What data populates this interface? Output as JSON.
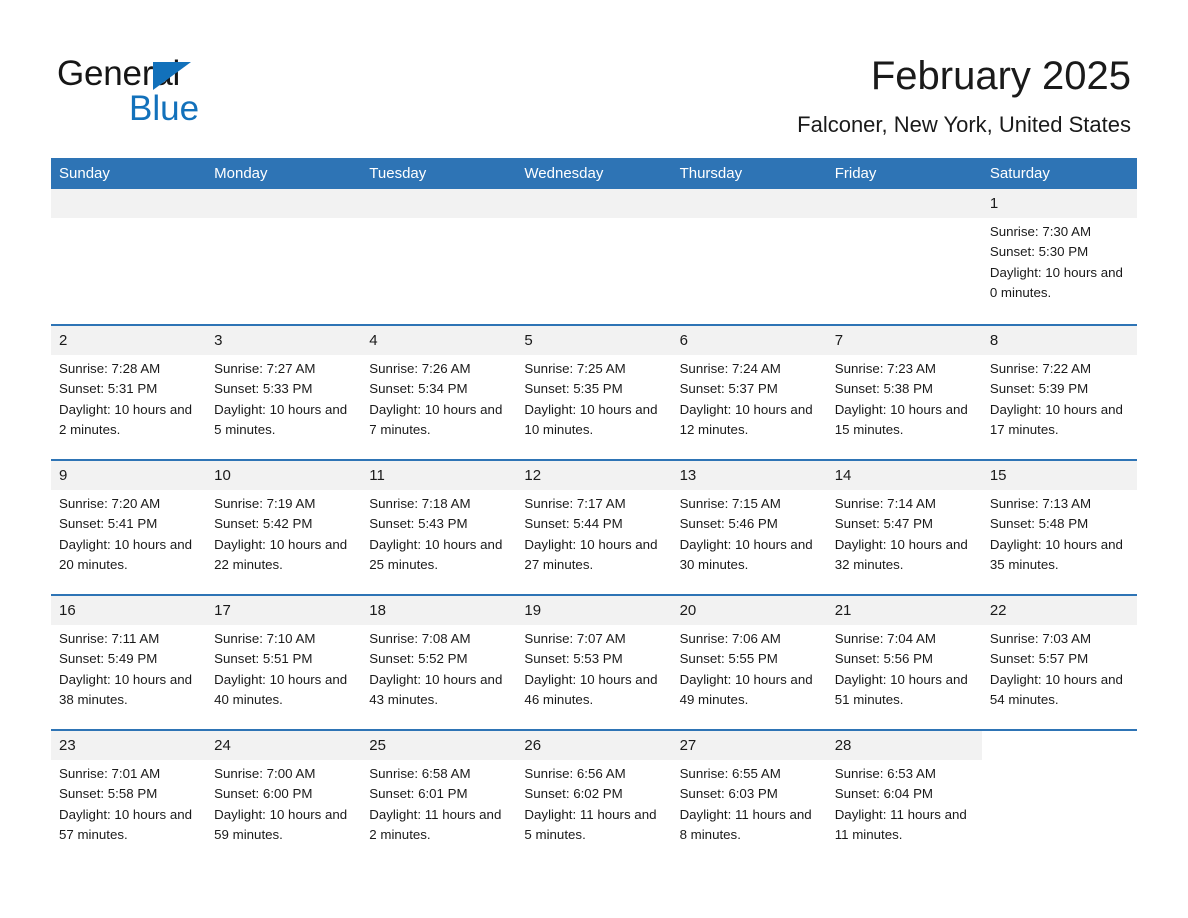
{
  "brand": {
    "word1": "General",
    "word2": "Blue",
    "flag_icon": "triangle-flag-icon",
    "accent_color": "#1271bb"
  },
  "header": {
    "title": "February 2025",
    "location": "Falconer, New York, United States"
  },
  "theme": {
    "header_bar_color": "#2e74b5",
    "date_band_color": "#f2f2f2",
    "text_color": "#1a1a1a"
  },
  "calendar": {
    "weekday_headers": [
      "Sunday",
      "Monday",
      "Tuesday",
      "Wednesday",
      "Thursday",
      "Friday",
      "Saturday"
    ],
    "weeks": [
      [
        {
          "day": "",
          "empty": true
        },
        {
          "day": "",
          "empty": true
        },
        {
          "day": "",
          "empty": true
        },
        {
          "day": "",
          "empty": true
        },
        {
          "day": "",
          "empty": true
        },
        {
          "day": "",
          "empty": true
        },
        {
          "day": "1",
          "sunrise": "Sunrise: 7:30 AM",
          "sunset": "Sunset: 5:30 PM",
          "daylight": "Daylight: 10 hours and 0 minutes."
        }
      ],
      [
        {
          "day": "2",
          "sunrise": "Sunrise: 7:28 AM",
          "sunset": "Sunset: 5:31 PM",
          "daylight": "Daylight: 10 hours and 2 minutes."
        },
        {
          "day": "3",
          "sunrise": "Sunrise: 7:27 AM",
          "sunset": "Sunset: 5:33 PM",
          "daylight": "Daylight: 10 hours and 5 minutes."
        },
        {
          "day": "4",
          "sunrise": "Sunrise: 7:26 AM",
          "sunset": "Sunset: 5:34 PM",
          "daylight": "Daylight: 10 hours and 7 minutes."
        },
        {
          "day": "5",
          "sunrise": "Sunrise: 7:25 AM",
          "sunset": "Sunset: 5:35 PM",
          "daylight": "Daylight: 10 hours and 10 minutes."
        },
        {
          "day": "6",
          "sunrise": "Sunrise: 7:24 AM",
          "sunset": "Sunset: 5:37 PM",
          "daylight": "Daylight: 10 hours and 12 minutes."
        },
        {
          "day": "7",
          "sunrise": "Sunrise: 7:23 AM",
          "sunset": "Sunset: 5:38 PM",
          "daylight": "Daylight: 10 hours and 15 minutes."
        },
        {
          "day": "8",
          "sunrise": "Sunrise: 7:22 AM",
          "sunset": "Sunset: 5:39 PM",
          "daylight": "Daylight: 10 hours and 17 minutes."
        }
      ],
      [
        {
          "day": "9",
          "sunrise": "Sunrise: 7:20 AM",
          "sunset": "Sunset: 5:41 PM",
          "daylight": "Daylight: 10 hours and 20 minutes."
        },
        {
          "day": "10",
          "sunrise": "Sunrise: 7:19 AM",
          "sunset": "Sunset: 5:42 PM",
          "daylight": "Daylight: 10 hours and 22 minutes."
        },
        {
          "day": "11",
          "sunrise": "Sunrise: 7:18 AM",
          "sunset": "Sunset: 5:43 PM",
          "daylight": "Daylight: 10 hours and 25 minutes."
        },
        {
          "day": "12",
          "sunrise": "Sunrise: 7:17 AM",
          "sunset": "Sunset: 5:44 PM",
          "daylight": "Daylight: 10 hours and 27 minutes."
        },
        {
          "day": "13",
          "sunrise": "Sunrise: 7:15 AM",
          "sunset": "Sunset: 5:46 PM",
          "daylight": "Daylight: 10 hours and 30 minutes."
        },
        {
          "day": "14",
          "sunrise": "Sunrise: 7:14 AM",
          "sunset": "Sunset: 5:47 PM",
          "daylight": "Daylight: 10 hours and 32 minutes."
        },
        {
          "day": "15",
          "sunrise": "Sunrise: 7:13 AM",
          "sunset": "Sunset: 5:48 PM",
          "daylight": "Daylight: 10 hours and 35 minutes."
        }
      ],
      [
        {
          "day": "16",
          "sunrise": "Sunrise: 7:11 AM",
          "sunset": "Sunset: 5:49 PM",
          "daylight": "Daylight: 10 hours and 38 minutes."
        },
        {
          "day": "17",
          "sunrise": "Sunrise: 7:10 AM",
          "sunset": "Sunset: 5:51 PM",
          "daylight": "Daylight: 10 hours and 40 minutes."
        },
        {
          "day": "18",
          "sunrise": "Sunrise: 7:08 AM",
          "sunset": "Sunset: 5:52 PM",
          "daylight": "Daylight: 10 hours and 43 minutes."
        },
        {
          "day": "19",
          "sunrise": "Sunrise: 7:07 AM",
          "sunset": "Sunset: 5:53 PM",
          "daylight": "Daylight: 10 hours and 46 minutes."
        },
        {
          "day": "20",
          "sunrise": "Sunrise: 7:06 AM",
          "sunset": "Sunset: 5:55 PM",
          "daylight": "Daylight: 10 hours and 49 minutes."
        },
        {
          "day": "21",
          "sunrise": "Sunrise: 7:04 AM",
          "sunset": "Sunset: 5:56 PM",
          "daylight": "Daylight: 10 hours and 51 minutes."
        },
        {
          "day": "22",
          "sunrise": "Sunrise: 7:03 AM",
          "sunset": "Sunset: 5:57 PM",
          "daylight": "Daylight: 10 hours and 54 minutes."
        }
      ],
      [
        {
          "day": "23",
          "sunrise": "Sunrise: 7:01 AM",
          "sunset": "Sunset: 5:58 PM",
          "daylight": "Daylight: 10 hours and 57 minutes."
        },
        {
          "day": "24",
          "sunrise": "Sunrise: 7:00 AM",
          "sunset": "Sunset: 6:00 PM",
          "daylight": "Daylight: 10 hours and 59 minutes."
        },
        {
          "day": "25",
          "sunrise": "Sunrise: 6:58 AM",
          "sunset": "Sunset: 6:01 PM",
          "daylight": "Daylight: 11 hours and 2 minutes."
        },
        {
          "day": "26",
          "sunrise": "Sunrise: 6:56 AM",
          "sunset": "Sunset: 6:02 PM",
          "daylight": "Daylight: 11 hours and 5 minutes."
        },
        {
          "day": "27",
          "sunrise": "Sunrise: 6:55 AM",
          "sunset": "Sunset: 6:03 PM",
          "daylight": "Daylight: 11 hours and 8 minutes."
        },
        {
          "day": "28",
          "sunrise": "Sunrise: 6:53 AM",
          "sunset": "Sunset: 6:04 PM",
          "daylight": "Daylight: 11 hours and 11 minutes."
        },
        {
          "day": "",
          "empty": true,
          "blank": true
        }
      ]
    ]
  }
}
